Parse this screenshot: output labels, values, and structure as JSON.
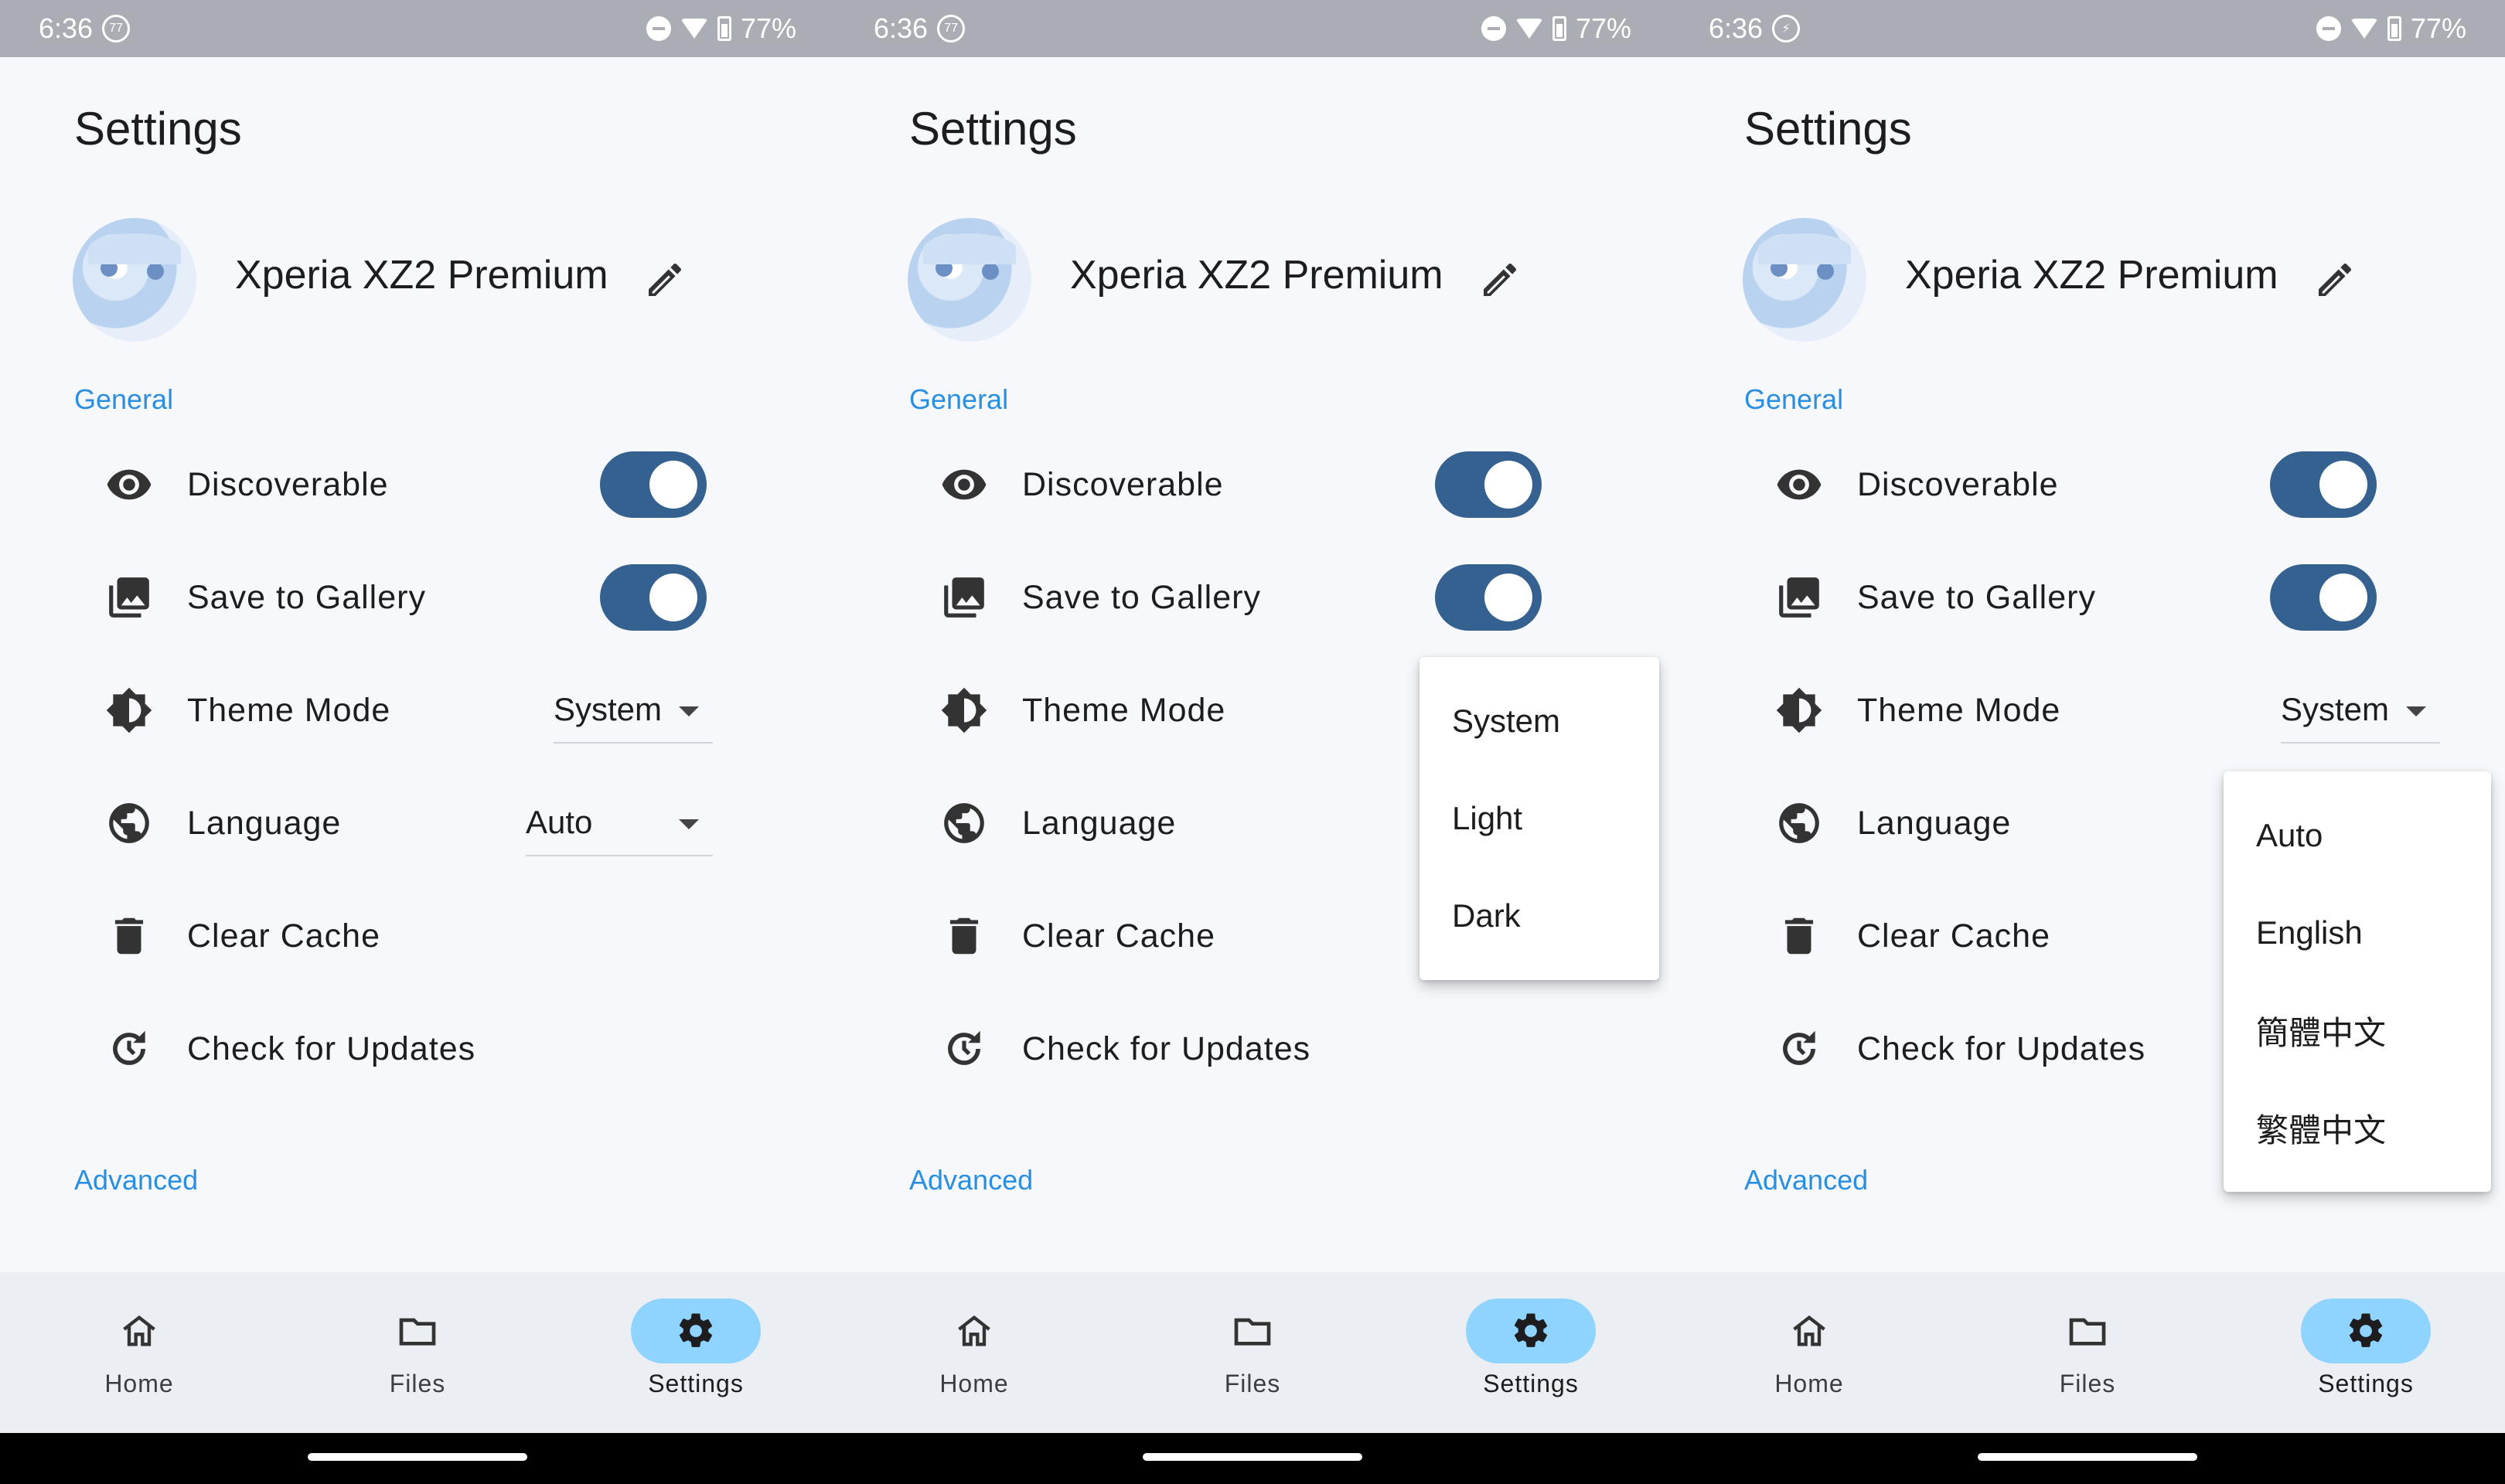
{
  "colors": {
    "accent": "#2a8fe0",
    "toggle_on": "#34618f",
    "nav_active_pill": "#8fd3ff",
    "status_bar": "#aaadb3",
    "background": "#f6f8fc"
  },
  "panels": [
    {
      "status": {
        "time": "6:36",
        "left_icon": "77",
        "battery": "77%"
      },
      "title": "Settings",
      "device_name": "Xperia XZ2 Premium",
      "section_general": "General",
      "section_advanced": "Advanced",
      "settings": {
        "discoverable": "Discoverable",
        "save_gallery": "Save to Gallery",
        "theme_mode": "Theme Mode",
        "language": "Language",
        "clear_cache": "Clear Cache",
        "check_updates": "Check for Updates"
      },
      "theme_value": "System",
      "language_value": "Auto",
      "nav": {
        "home": "Home",
        "files": "Files",
        "settings": "Settings"
      }
    },
    {
      "status": {
        "time": "6:36",
        "left_icon": "77",
        "battery": "77%"
      },
      "title": "Settings",
      "device_name": "Xperia XZ2 Premium",
      "section_general": "General",
      "section_advanced": "Advanced",
      "settings": {
        "discoverable": "Discoverable",
        "save_gallery": "Save to Gallery",
        "theme_mode": "Theme Mode",
        "language": "Language",
        "clear_cache": "Clear Cache",
        "check_updates": "Check for Updates"
      },
      "theme_menu": [
        "System",
        "Light",
        "Dark"
      ],
      "nav": {
        "home": "Home",
        "files": "Files",
        "settings": "Settings"
      }
    },
    {
      "status": {
        "time": "6:36",
        "left_icon": "",
        "battery": "77%"
      },
      "title": "Settings",
      "device_name": "Xperia XZ2 Premium",
      "section_general": "General",
      "section_advanced": "Advanced",
      "settings": {
        "discoverable": "Discoverable",
        "save_gallery": "Save to Gallery",
        "theme_mode": "Theme Mode",
        "language": "Language",
        "clear_cache": "Clear Cache",
        "check_updates": "Check for Updates"
      },
      "theme_value": "System",
      "language_menu": [
        "Auto",
        "English",
        "簡體中文",
        "繁體中文"
      ],
      "nav": {
        "home": "Home",
        "files": "Files",
        "settings": "Settings"
      }
    }
  ]
}
